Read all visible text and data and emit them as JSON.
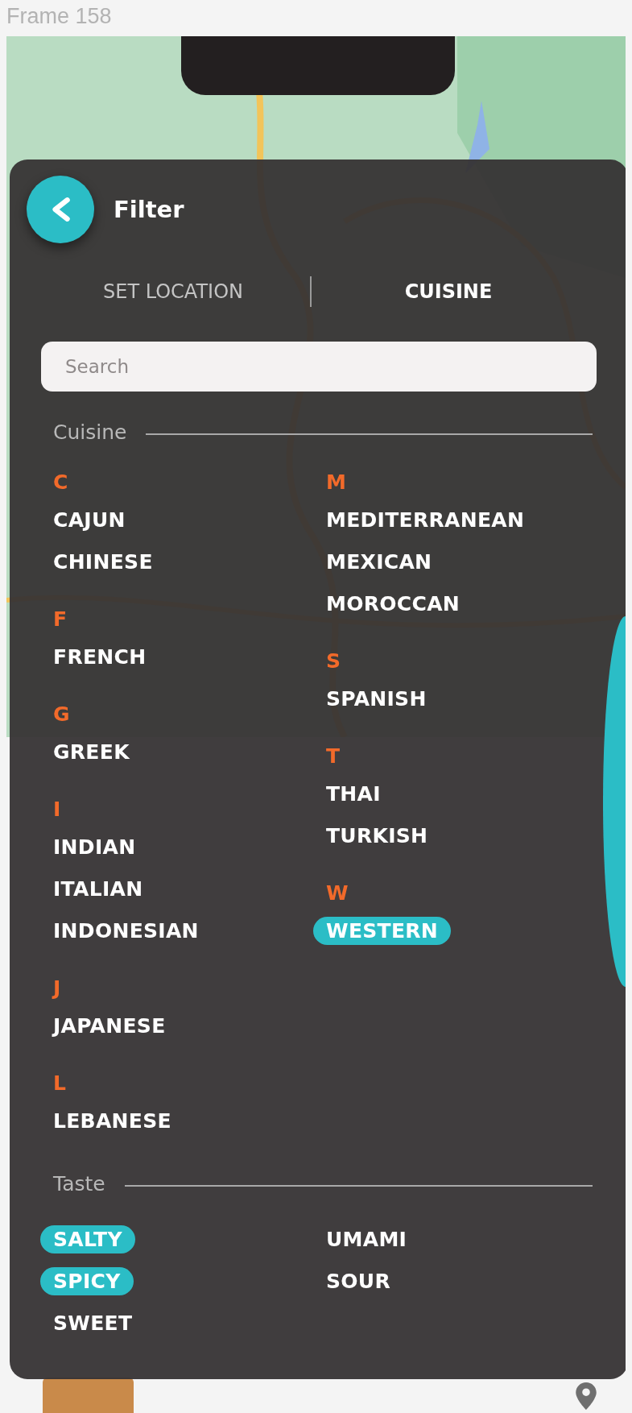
{
  "frame_label": "Frame 158",
  "filter": {
    "title": "Filter",
    "tabs": [
      {
        "label": "SET LOCATION",
        "selected": false
      },
      {
        "label": "CUISINE",
        "selected": true
      }
    ],
    "search": {
      "placeholder": "Search"
    },
    "sections": [
      {
        "title": "Cuisine",
        "columns": [
          [
            {
              "letter": "C",
              "items": [
                {
                  "label": "CAJUN",
                  "selected": false
                },
                {
                  "label": "CHINESE",
                  "selected": false
                }
              ]
            },
            {
              "letter": "F",
              "items": [
                {
                  "label": "FRENCH",
                  "selected": false
                }
              ]
            },
            {
              "letter": "G",
              "items": [
                {
                  "label": "GREEK",
                  "selected": false
                }
              ]
            },
            {
              "letter": "I",
              "items": [
                {
                  "label": "INDIAN",
                  "selected": false
                },
                {
                  "label": "ITALIAN",
                  "selected": false
                },
                {
                  "label": "INDONESIAN",
                  "selected": false
                }
              ]
            },
            {
              "letter": "J",
              "items": [
                {
                  "label": "JAPANESE",
                  "selected": false
                }
              ]
            },
            {
              "letter": "L",
              "items": [
                {
                  "label": "LEBANESE",
                  "selected": false
                }
              ]
            }
          ],
          [
            {
              "letter": "M",
              "items": [
                {
                  "label": "MEDITERRANEAN",
                  "selected": false
                },
                {
                  "label": "MEXICAN",
                  "selected": false
                },
                {
                  "label": "MOROCCAN",
                  "selected": false
                }
              ]
            },
            {
              "letter": "S",
              "items": [
                {
                  "label": "SPANISH",
                  "selected": false
                }
              ]
            },
            {
              "letter": "T",
              "items": [
                {
                  "label": "THAI",
                  "selected": false
                },
                {
                  "label": "TURKISH",
                  "selected": false
                }
              ]
            },
            {
              "letter": "W",
              "items": [
                {
                  "label": "WESTERN",
                  "selected": true
                }
              ]
            }
          ]
        ]
      },
      {
        "title": "Taste",
        "columns": [
          [
            {
              "items": [
                {
                  "label": "SALTY",
                  "selected": true
                },
                {
                  "label": "SPICY",
                  "selected": true
                },
                {
                  "label": "SWEET",
                  "selected": false
                }
              ]
            }
          ],
          [
            {
              "items": [
                {
                  "label": "UMAMI",
                  "selected": false
                },
                {
                  "label": "SOUR",
                  "selected": false
                }
              ]
            }
          ]
        ]
      }
    ]
  }
}
